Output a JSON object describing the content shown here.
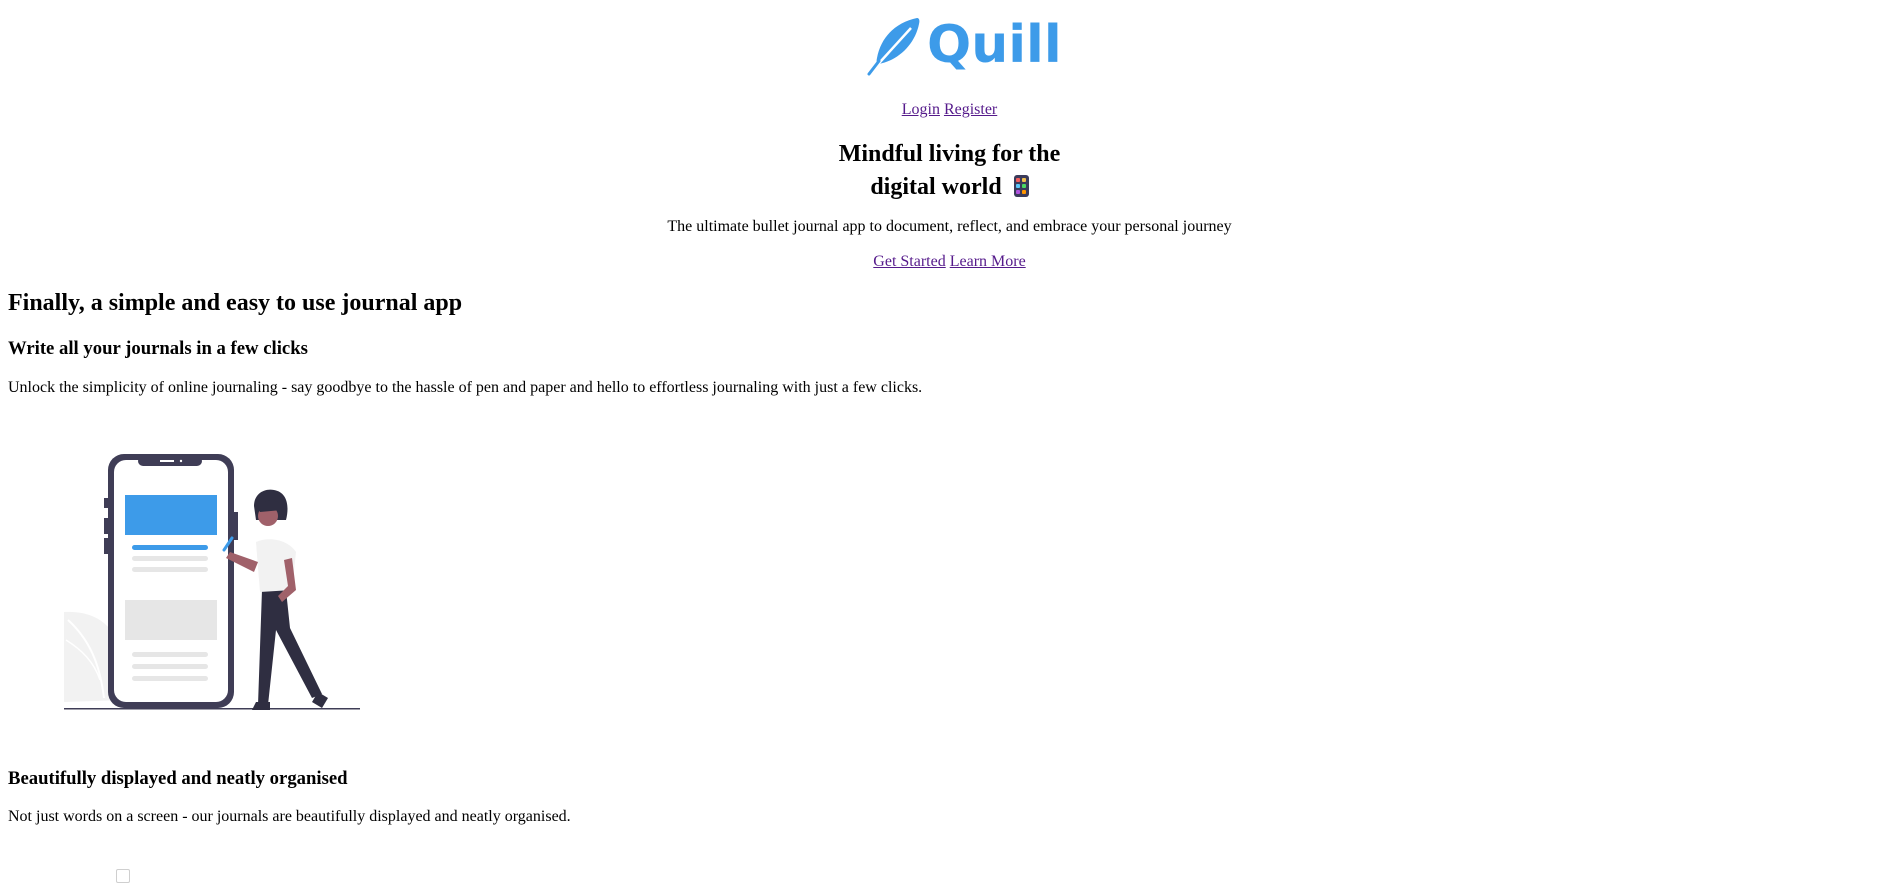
{
  "brand": {
    "name": "Quill",
    "color": "#3d9be9",
    "logo_icon": "feather-icon"
  },
  "auth_nav": {
    "login": "Login",
    "register": "Register"
  },
  "hero": {
    "title_line1": "Mindful living for the",
    "title_line2": "digital world",
    "title_icon": "mobile-phone-emoji",
    "subtitle": "The ultimate bullet journal app to document, reflect, and embrace your personal journey",
    "get_started": "Get Started",
    "learn_more": "Learn More"
  },
  "features": {
    "heading": "Finally, a simple and easy to use journal app",
    "items": [
      {
        "title": "Write all your journals in a few clicks",
        "description": "Unlock the simplicity of online journaling - say goodbye to the hassle of pen and paper and hello to effortless journaling with just a few clicks.",
        "illustration": "woman-with-phone-illustration"
      },
      {
        "title": "Beautifully displayed and neatly organised",
        "description": "Not just words on a screen - our journals are beautifully displayed and neatly organised."
      }
    ]
  },
  "colors": {
    "link": "#551a8b",
    "accent": "#3d9be9",
    "dark": "#3f3d56"
  }
}
